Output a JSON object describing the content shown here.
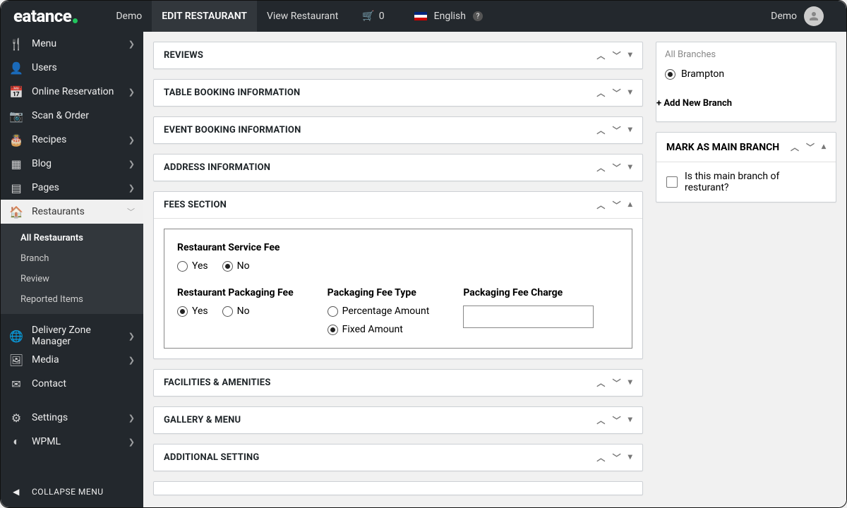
{
  "brand": "eatance",
  "top": {
    "demo": "Demo",
    "edit": "EDIT RESTAURANT",
    "view": "View Restaurant",
    "cart_count": "0",
    "lang": "English",
    "user": "Demo"
  },
  "sidebar": {
    "items": [
      {
        "label": "Menu",
        "icon": "🍴",
        "chev": true
      },
      {
        "label": "Users",
        "icon": "👤",
        "chev": false
      },
      {
        "label": "Online Reservation",
        "icon": "📅",
        "chev": true
      },
      {
        "label": "Scan & Order",
        "icon": "📷",
        "chev": false
      },
      {
        "label": "Recipes",
        "icon": "🎂",
        "chev": true
      },
      {
        "label": "Blog",
        "icon": "▦",
        "chev": true
      },
      {
        "label": "Pages",
        "icon": "▤",
        "chev": true
      },
      {
        "label": "Restaurants",
        "icon": "🏠",
        "chev": true,
        "active": true
      },
      {
        "label": "Delivery Zone Manager",
        "icon": "🌐",
        "chev": true,
        "gapTop": true
      },
      {
        "label": "Media",
        "icon": "🖼",
        "chev": true
      },
      {
        "label": "Contact",
        "icon": "✉",
        "chev": false
      },
      {
        "label": "Settings",
        "icon": "⚙",
        "chev": true,
        "gapTop": true
      },
      {
        "label": "WPML",
        "icon": "◐",
        "chev": true
      }
    ],
    "sub": [
      "All Restaurants",
      "Branch",
      "Review",
      "Reported Items"
    ],
    "collapse": "COLLAPSE MENU"
  },
  "panels": {
    "reviews": "REVIEWS",
    "table": "TABLE BOOKING INFORMATION",
    "event": "EVENT BOOKING INFORMATION",
    "address": "ADDRESS INFORMATION",
    "fees": "FEES SECTION",
    "facilities": "FACILITIES & AMENITIES",
    "gallery": "GALLERY & MENU",
    "additional": "ADDITIONAL SETTING"
  },
  "fees": {
    "service_label": "Restaurant Service Fee",
    "packaging_label": "Restaurant Packaging Fee",
    "type_label": "Packaging Fee Type",
    "charge_label": "Packaging Fee Charge",
    "yes": "Yes",
    "no": "No",
    "percentage": "Percentage Amount",
    "fixed": "Fixed Amount",
    "service_value": "No",
    "packaging_value": "Yes",
    "type_value": "Fixed Amount",
    "charge_value": ""
  },
  "right": {
    "all_branches": "All Branches",
    "branch1": "Brampton",
    "add_branch": "+ Add New Branch",
    "mark_title": "MARK AS MAIN BRANCH",
    "mark_check": "Is this main branch of resturant?"
  }
}
